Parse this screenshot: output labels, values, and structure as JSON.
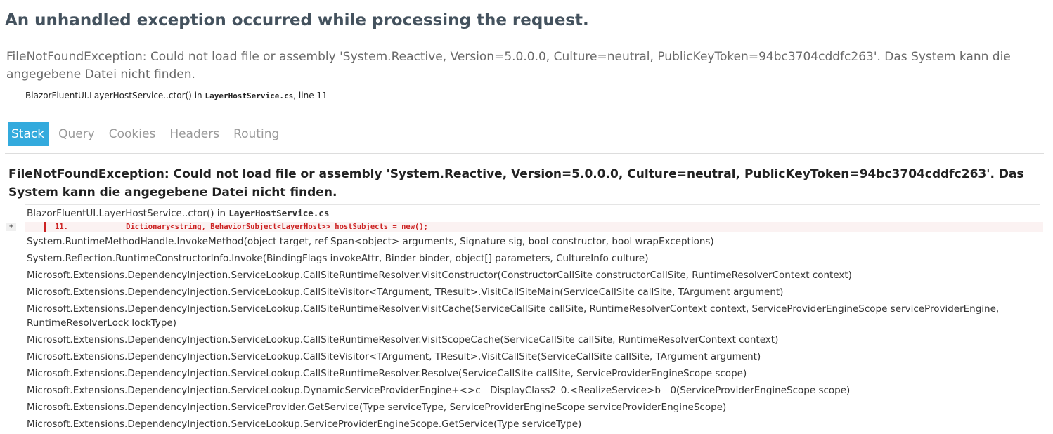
{
  "header": {
    "title": "An unhandled exception occurred while processing the request.",
    "error_message": "FileNotFoundException: Could not load file or assembly 'System.Reactive, Version=5.0.0.0, Culture=neutral, PublicKeyToken=94bc3704cddfc263'. Das System kann die angegebene Datei nicht finden.",
    "location": {
      "method": "BlazorFluentUI.LayerHostService..ctor()",
      "in_text": " in ",
      "file": "LayerHostService.cs",
      "line_text": ", line 11"
    }
  },
  "tabs": [
    {
      "label": "Stack",
      "selected": true
    },
    {
      "label": "Query",
      "selected": false
    },
    {
      "label": "Cookies",
      "selected": false
    },
    {
      "label": "Headers",
      "selected": false
    },
    {
      "label": "Routing",
      "selected": false
    }
  ],
  "stack": {
    "error_title": "FileNotFoundException: Could not load file or assembly 'System.Reactive, Version=5.0.0.0, Culture=neutral, PublicKeyToken=94bc3704cddfc263'. Das System kann die angegebene Datei nicht finden.",
    "first_frame": {
      "method": "BlazorFluentUI.LayerHostService..ctor()",
      "in_text": " in ",
      "file": "LayerHostService.cs",
      "expander": "+",
      "code_line": "11.             Dictionary<string, BehaviorSubject<LayerHost>> hostSubjects = new();"
    },
    "frames": [
      "System.RuntimeMethodHandle.InvokeMethod(object target, ref Span<object> arguments, Signature sig, bool constructor, bool wrapExceptions)",
      "System.Reflection.RuntimeConstructorInfo.Invoke(BindingFlags invokeAttr, Binder binder, object[] parameters, CultureInfo culture)",
      "Microsoft.Extensions.DependencyInjection.ServiceLookup.CallSiteRuntimeResolver.VisitConstructor(ConstructorCallSite constructorCallSite, RuntimeResolverContext context)",
      "Microsoft.Extensions.DependencyInjection.ServiceLookup.CallSiteVisitor<TArgument, TResult>.VisitCallSiteMain(ServiceCallSite callSite, TArgument argument)",
      "Microsoft.Extensions.DependencyInjection.ServiceLookup.CallSiteRuntimeResolver.VisitCache(ServiceCallSite callSite, RuntimeResolverContext context, ServiceProviderEngineScope serviceProviderEngine, RuntimeResolverLock lockType)",
      "Microsoft.Extensions.DependencyInjection.ServiceLookup.CallSiteRuntimeResolver.VisitScopeCache(ServiceCallSite callSite, RuntimeResolverContext context)",
      "Microsoft.Extensions.DependencyInjection.ServiceLookup.CallSiteVisitor<TArgument, TResult>.VisitCallSite(ServiceCallSite callSite, TArgument argument)",
      "Microsoft.Extensions.DependencyInjection.ServiceLookup.CallSiteRuntimeResolver.Resolve(ServiceCallSite callSite, ServiceProviderEngineScope scope)",
      "Microsoft.Extensions.DependencyInjection.ServiceLookup.DynamicServiceProviderEngine+<>c__DisplayClass2_0.<RealizeService>b__0(ServiceProviderEngineScope scope)",
      "Microsoft.Extensions.DependencyInjection.ServiceProvider.GetService(Type serviceType, ServiceProviderEngineScope serviceProviderEngineScope)",
      "Microsoft.Extensions.DependencyInjection.ServiceLookup.ServiceProviderEngineScope.GetService(Type serviceType)"
    ]
  },
  "colors": {
    "tab_selected_bg": "#33aadd",
    "code_highlight": "#cc2222",
    "title": "#44525e"
  }
}
